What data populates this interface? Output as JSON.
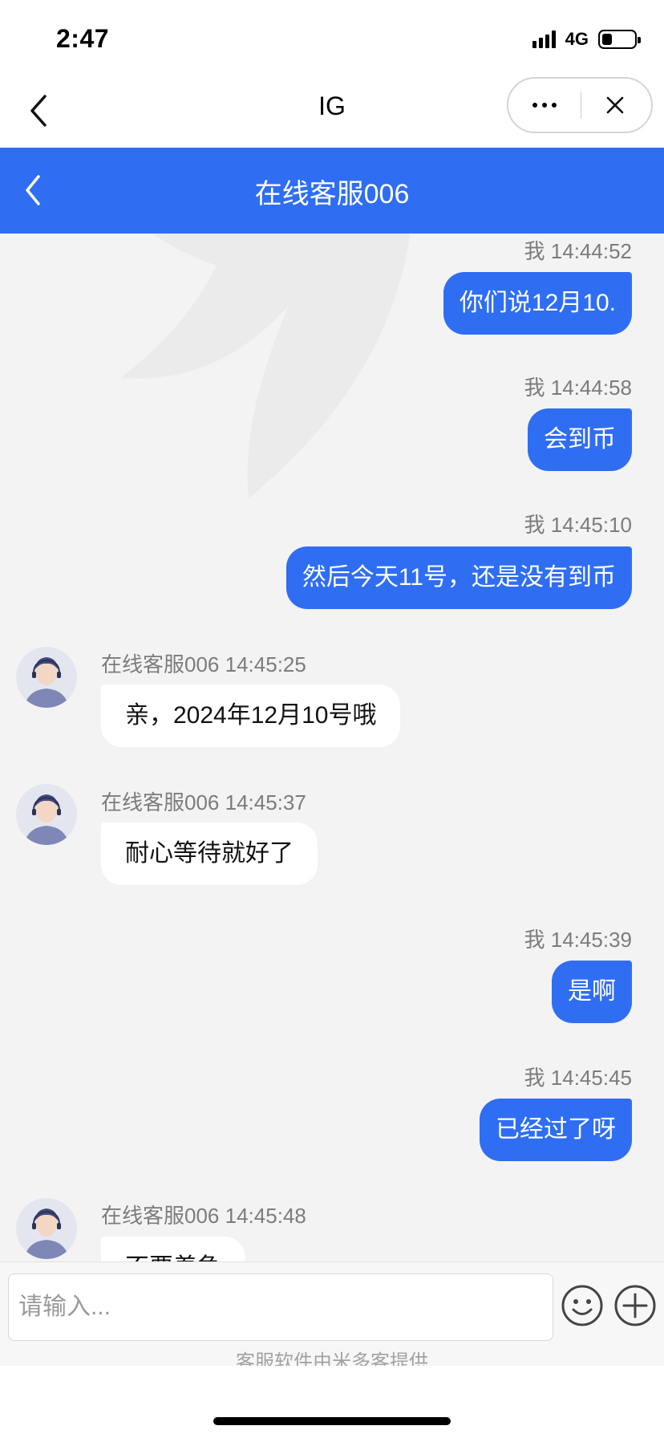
{
  "status_bar": {
    "time": "2:47",
    "network": "4G",
    "battery_level": 0.3
  },
  "mini_header": {
    "title": "IG"
  },
  "chat_header": {
    "title": "在线客服006"
  },
  "messages": [
    {
      "sender": "我",
      "time": "14:44:52",
      "text": "你们说12月10."
    },
    {
      "sender": "我",
      "time": "14:44:58",
      "text": "会到币"
    },
    {
      "sender": "我",
      "time": "14:45:10",
      "text": "然后今天11号，还是没有到币"
    },
    {
      "sender": "在线客服006",
      "time": "14:45:25",
      "text": "亲，2024年12月10号哦"
    },
    {
      "sender": "在线客服006",
      "time": "14:45:37",
      "text": "耐心等待就好了"
    },
    {
      "sender": "我",
      "time": "14:45:39",
      "text": "是啊"
    },
    {
      "sender": "我",
      "time": "14:45:45",
      "text": "已经过了呀"
    },
    {
      "sender": "在线客服006",
      "time": "14:45:48",
      "text": "不要着急"
    }
  ],
  "input": {
    "placeholder": "请输入..."
  },
  "footer": {
    "powered_by": "客服软件由米多客提供"
  },
  "colors": {
    "accent": "#2f6ef3",
    "chat_bg": "#f3f3f3",
    "agent_bubble": "#ffffff"
  },
  "icons": [
    "back-arrow-icon",
    "more-dots-icon",
    "close-icon",
    "emoji-icon",
    "plus-icon",
    "agent-avatar-icon"
  ]
}
